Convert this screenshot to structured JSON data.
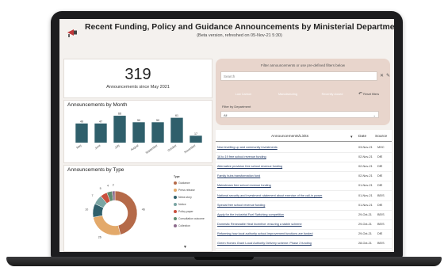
{
  "header": {
    "title": "Recent Funding, Policy and Guidance Announcements by Ministerial Departments",
    "subtitle": "(Beta version, refreshed on 05-Nov-21 5:30)"
  },
  "kpi": {
    "value": "319",
    "caption": "Announcements since May 2021"
  },
  "month_chart": {
    "title": "Announcements by Month",
    "chart_data": {
      "type": "bar",
      "categories": [
        "May",
        "June",
        "July",
        "August",
        "September",
        "October",
        "November"
      ],
      "values": [
        47,
        47,
        66,
        50,
        50,
        61,
        17
      ],
      "value_labels": [
        "49",
        "47",
        "66",
        "50",
        "50",
        "61",
        "17"
      ],
      "ylim": [
        0,
        70
      ]
    },
    "bar_color": "#2f5f6b"
  },
  "type_chart": {
    "title": "Announcements by Type",
    "legend_title": "Type",
    "chart_data": {
      "type": "pie",
      "labels": [
        "Guidance",
        "Press release",
        "News story",
        "Notice",
        "Policy paper",
        "Consultation outcome",
        "Collection"
      ],
      "values": [
        46,
        26,
        10,
        7,
        5,
        4,
        2
      ]
    },
    "colors": [
      "#b56a49",
      "#e3a96a",
      "#2f5f6b",
      "#7aa5a3",
      "#c94f3d",
      "#5f8b70",
      "#8c6b8c"
    ],
    "data_labels": [
      "46",
      "26",
      "10",
      "7",
      "5",
      "4",
      "2"
    ]
  },
  "filters": {
    "title": "Filter announcements or use pre-defined filters below",
    "search_placeholder": "Search",
    "pills": [
      {
        "label": "Low Carbon",
        "color": "#3f8a6a"
      },
      {
        "label": "Manufacturing",
        "color": "#2f5f6b"
      },
      {
        "label": "Recently closed",
        "color": "#cf6a54"
      }
    ],
    "reset_label": "Reset filters",
    "dept_label": "Filter by Department",
    "dept_value": "All"
  },
  "table": {
    "headers": {
      "name": "Announcements/Links",
      "date": "Date",
      "source": "Source"
    },
    "rows": [
      {
        "title": "New levelling up and community investments",
        "date": "03-Nov-21",
        "source": "MHC"
      },
      {
        "title": "16 to 19 free school revenue funding",
        "date": "02-Nov-21",
        "source": "DfE"
      },
      {
        "title": "Alternative provision free school revenue funding",
        "date": "02-Nov-21",
        "source": "DfE"
      },
      {
        "title": "Family hubs transformation fund",
        "date": "02-Nov-21",
        "source": "DfE"
      },
      {
        "title": "Mainstream free school revenue funding",
        "date": "01-Nov-21",
        "source": "DfE"
      },
      {
        "title": "National security and investment: statement about exercise of the call-in power",
        "date": "01-Nov-21",
        "source": "BEIS"
      },
      {
        "title": "Special free school revenue funding",
        "date": "01-Nov-21",
        "source": "DfE"
      },
      {
        "title": "Apply for the Industrial Fuel Switching competition",
        "date": "29-Oct-21",
        "source": "BEIS"
      },
      {
        "title": "Domestic Renewable Heat Incentive: ensuring a stable scheme",
        "date": "29-Oct-21",
        "source": "BEIS"
      },
      {
        "title": "Reforming how local authority school improvement functions are funded",
        "date": "29-Oct-21",
        "source": "DfE"
      },
      {
        "title": "Green Homes Grant Local Authority Delivery scheme: Phase 2 funding",
        "date": "28-Oct-21",
        "source": "BEIS"
      }
    ]
  }
}
